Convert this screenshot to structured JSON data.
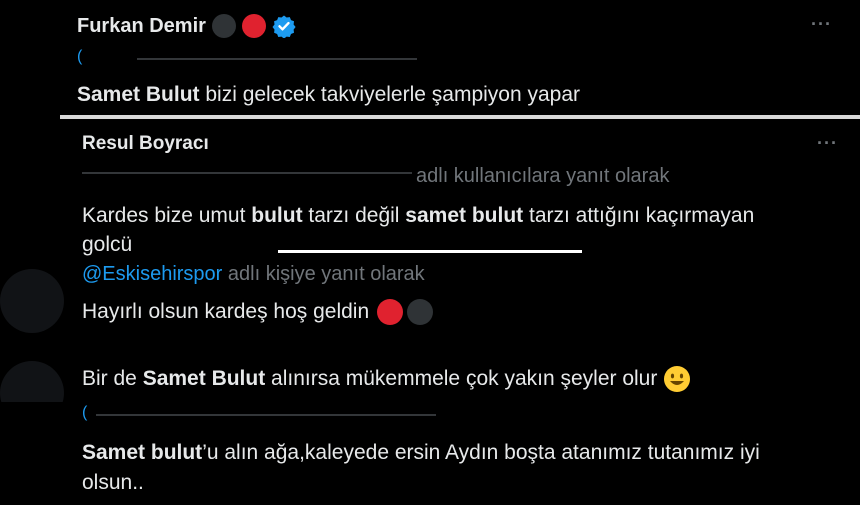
{
  "tweet1": {
    "name": "Furkan Demir",
    "badge_colors": [
      "#2f3336",
      "#e0222f"
    ],
    "verified_color": "#1d9bf0",
    "menu": "···",
    "text_bold": "Samet Bulut",
    "text_rest": " bizi gelecek takviyelerle şampiyon yapar"
  },
  "tweet2": {
    "name": "Resul Boyracı",
    "menu": "···",
    "reply_suffix": "adlı kullanıcılara yanıt olarak",
    "t1": "Kardes bize umut ",
    "b1": "bulut",
    "t2": " tarzı değil ",
    "b2": "samet bulut",
    "t3": " tarzı attığını kaçırmayan",
    "line2": "golcü"
  },
  "tweet3": {
    "handle": "@Eskisehirspor",
    "reply_suffix": "adlı kişiye yanıt olarak",
    "text": "Hayırlı olsun kardeş hoş geldin",
    "emoji_colors": [
      "#e0222f",
      "#2f3336"
    ]
  },
  "tweet4": {
    "t1": "Bir de ",
    "b1": "Samet Bulut",
    "t2": " alınırsa mükemmele çok yakın şeyler olur"
  },
  "tweet5": {
    "b1": "Samet bulut",
    "t1": "’u alın ağa,kaleyede ersin Aydın boşta atanımız tutanımız iyi",
    "line2": "olsun.."
  }
}
